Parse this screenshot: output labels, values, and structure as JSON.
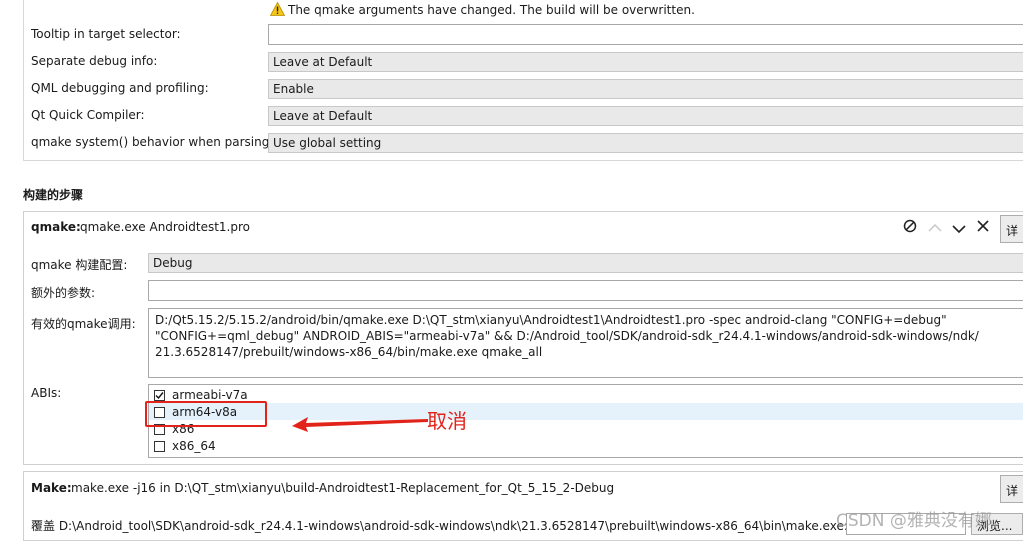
{
  "warning": {
    "icon": "warning-triangle-icon",
    "text": "The qmake arguments have changed. The build will be overwritten."
  },
  "settings": [
    {
      "label": "Tooltip in target selector:",
      "value": ""
    },
    {
      "label": "Separate debug info:",
      "value": "Leave at Default"
    },
    {
      "label": "QML debugging and profiling:",
      "value": "Enable"
    },
    {
      "label": "Qt Quick Compiler:",
      "value": "Leave at Default"
    },
    {
      "label": "qmake system() behavior when parsing:",
      "value": "Use global setting"
    }
  ],
  "build_steps": {
    "heading": "构建的步骤",
    "qmake": {
      "title_bold": "qmake:",
      "title_rest": "qmake.exe Androidtest1.pro",
      "details_label": "详",
      "config_label": "qmake 构建配置:",
      "config_value": "Debug",
      "extra_args_label": "额外的参数:",
      "extra_args_value": "",
      "effective_call_label": "有效的qmake调用:",
      "effective_call_lines": [
        "D:/Qt5.15.2/5.15.2/android/bin/qmake.exe D:\\QT_stm\\xianyu\\Androidtest1\\Androidtest1.pro -spec android-clang \"CONFIG+=debug\"",
        "\"CONFIG+=qml_debug\" ANDROID_ABIS=\"armeabi-v7a\" && D:/Android_tool/SDK/android-sdk_r24.4.1-windows/android-sdk-windows/ndk/",
        "21.3.6528147/prebuilt/windows-x86_64/bin/make.exe qmake_all"
      ],
      "abis_label": "ABIs:",
      "abis": [
        {
          "name": "armeabi-v7a",
          "checked": true
        },
        {
          "name": "arm64-v8a",
          "checked": false
        },
        {
          "name": "x86",
          "checked": false
        },
        {
          "name": "x86_64",
          "checked": false
        }
      ],
      "annotation": "取消"
    },
    "make": {
      "title_bold": "Make:",
      "title_rest": "make.exe -j16 in D:\\QT_stm\\xianyu\\build-Androidtest1-Replacement_for_Qt_5_15_2-Debug",
      "details_label": "详",
      "override_label": "覆盖 D:\\Android_tool\\SDK\\android-sdk_r24.4.1-windows\\android-sdk-windows\\ndk\\21.3.6528147\\prebuilt\\windows-x86_64\\bin\\make.exe:",
      "browse_label": "浏览..."
    }
  },
  "watermark": "CSDN @雅典没有娜",
  "colors": {
    "highlight_row": "#e5f1fb",
    "annotation_red": "#e2231a",
    "combo_bg": "#e9e9e9"
  }
}
